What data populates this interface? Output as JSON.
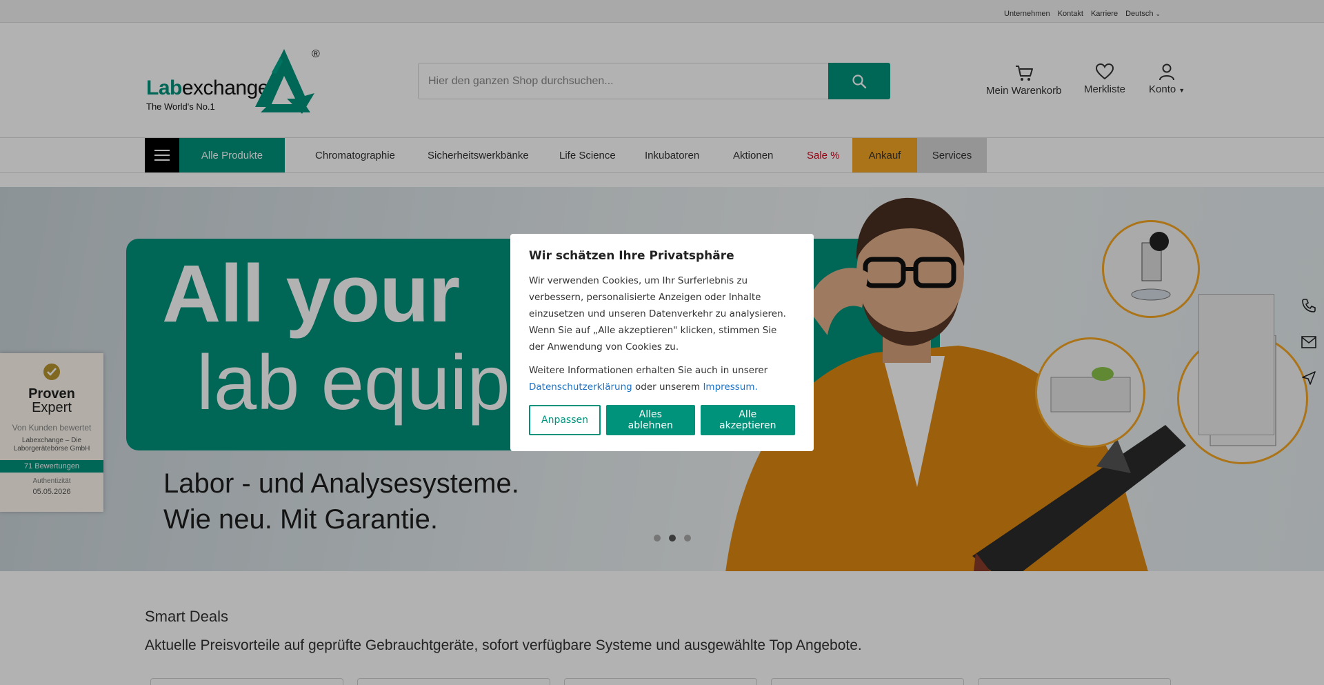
{
  "topbar": {
    "links": [
      "Unternehmen",
      "Kontakt",
      "Karriere"
    ],
    "language": "Deutsch"
  },
  "logo": {
    "word_green": "Lab",
    "word_dark": "exchange",
    "registered": "®",
    "tagline": "The World's No.1"
  },
  "search": {
    "placeholder": "Hier den ganzen Shop durchsuchen...",
    "icon": "search-icon"
  },
  "header_actions": {
    "cart": "Mein Warenkorb",
    "wishlist": "Merkliste",
    "account": "Konto"
  },
  "nav": {
    "all_products": "Alle Produkte",
    "items": [
      "Chromatographie",
      "Sicherheitswerkbänke",
      "Life Science",
      "Inkubatoren",
      "Aktionen",
      "Sale %",
      "Ankauf",
      "Services"
    ]
  },
  "hero": {
    "headline_1": "All your",
    "headline_2": "lab equip",
    "sub_1": "Labor - und Analysesysteme.",
    "sub_2": "Wie neu. Mit Garantie.",
    "slides": 3,
    "active_slide": 2
  },
  "proven_expert": {
    "title_1": "Proven",
    "title_2": "Expert",
    "by_customers": "Von Kunden bewertet",
    "company": "Labexchange – Die Laborgerätebörse GmbH",
    "reviews": "71 Bewertungen",
    "authenticity": "Authentizität",
    "date": "05.05.2026"
  },
  "deals": {
    "title": "Smart Deals",
    "subtitle": "Aktuelle Preisvorteile auf geprüfte Gebrauchtgeräte, sofort verfügbare Systeme und ausgewählte Top Angebote."
  },
  "cookie_modal": {
    "title": "Wir schätzen Ihre Privatsphäre",
    "text": "Wir verwenden Cookies, um Ihr Surferlebnis zu verbessern, personalisierte Anzeigen oder Inhalte einzusetzen und unseren Datenverkehr zu analysieren. Wenn Sie auf „Alle akzeptieren\" klicken, stimmen Sie der Anwendung von Cookies zu.",
    "more_prefix": "Weitere Informationen erhalten Sie auch in unserer",
    "privacy_link": "Datenschutzerklärung",
    "more_middle": "oder unserem",
    "imprint_link": "Impressum.",
    "btn_customize": "Anpassen",
    "btn_reject": "Alles ablehnen",
    "btn_accept": "Alle akzeptieren"
  },
  "colors": {
    "brand_green": "#00937c",
    "ankauf": "#f5a623",
    "sale": "#d0021b"
  }
}
